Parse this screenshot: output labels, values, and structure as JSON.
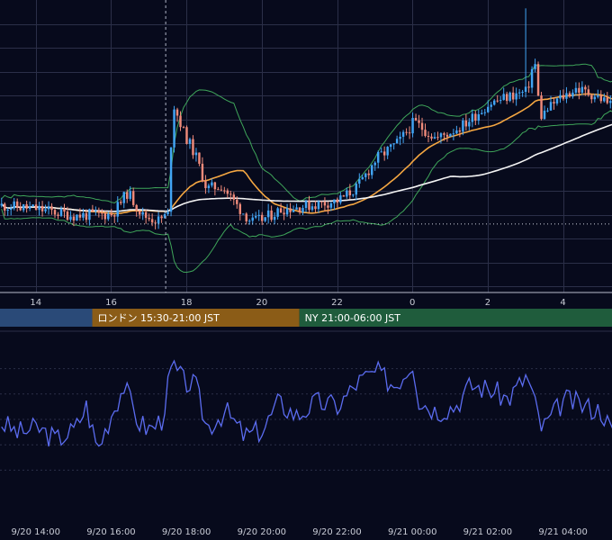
{
  "chart_data": [
    {
      "type": "candlestick",
      "x_ticks": [
        {
          "label": "14",
          "hours": 14
        },
        {
          "label": "16",
          "hours": 16
        },
        {
          "label": "18",
          "hours": 18
        },
        {
          "label": "20",
          "hours": 20
        },
        {
          "label": "22",
          "hours": 22
        },
        {
          "label": "0",
          "hours": 24
        },
        {
          "label": "2",
          "hours": 26
        },
        {
          "label": "4",
          "hours": 28
        }
      ],
      "x_range_hours": [
        13.05,
        29.3
      ],
      "price_anchors": [
        {
          "hours": 13.05,
          "price": 0.52
        },
        {
          "hours": 14.0,
          "price": 0.5
        },
        {
          "hours": 15.0,
          "price": 0.46
        },
        {
          "hours": 16.0,
          "price": 0.47
        },
        {
          "hours": 16.4,
          "price": 0.6
        },
        {
          "hours": 16.8,
          "price": 0.46
        },
        {
          "hours": 17.2,
          "price": 0.43
        },
        {
          "hours": 17.5,
          "price": 0.47
        },
        {
          "hours": 17.58,
          "price": 1.15
        },
        {
          "hours": 17.9,
          "price": 0.95
        },
        {
          "hours": 18.2,
          "price": 0.82
        },
        {
          "hours": 18.5,
          "price": 0.62
        },
        {
          "hours": 18.9,
          "price": 0.64
        },
        {
          "hours": 19.3,
          "price": 0.52
        },
        {
          "hours": 19.7,
          "price": 0.42
        },
        {
          "hours": 20.0,
          "price": 0.44
        },
        {
          "hours": 20.5,
          "price": 0.5
        },
        {
          "hours": 21.2,
          "price": 0.52
        },
        {
          "hours": 22.0,
          "price": 0.55
        },
        {
          "hours": 22.5,
          "price": 0.63
        },
        {
          "hours": 23.0,
          "price": 0.8
        },
        {
          "hours": 23.6,
          "price": 0.9
        },
        {
          "hours": 24.0,
          "price": 1.02
        },
        {
          "hours": 24.6,
          "price": 0.92
        },
        {
          "hours": 25.3,
          "price": 1.0
        },
        {
          "hours": 26.0,
          "price": 1.13
        },
        {
          "hours": 26.6,
          "price": 1.18
        },
        {
          "hours": 27.0,
          "price": 1.2
        },
        {
          "hours": 27.2,
          "price": 1.4
        },
        {
          "hours": 27.35,
          "price": 1.05
        },
        {
          "hours": 27.8,
          "price": 1.15
        },
        {
          "hours": 28.3,
          "price": 1.22
        },
        {
          "hours": 28.8,
          "price": 1.18
        },
        {
          "hours": 29.3,
          "price": 1.12
        }
      ],
      "spike_high": {
        "hours": 27.0,
        "price": 1.7
      },
      "dashed_price_level": 0.41,
      "vertical_marker_hours": 17.45,
      "y_range": [
        0,
        1.75
      ],
      "overlays": [
        "Bollinger Bands",
        "Moving Average",
        "Moving Average"
      ],
      "colors": {
        "up": "#42a5f5",
        "down": "#ef8a7a",
        "bollinger": "#3fa65a",
        "ma_short": "#f5a742",
        "ma_long": "#f4f4f4",
        "grid": "#2b2f48",
        "background": "#070a1c"
      },
      "grid": true
    },
    {
      "type": "line",
      "x_ticks": [
        {
          "label": "9/20 14:00",
          "hours": 14
        },
        {
          "label": "9/20 16:00",
          "hours": 16
        },
        {
          "label": "9/20 18:00",
          "hours": 18
        },
        {
          "label": "9/20 20:00",
          "hours": 20
        },
        {
          "label": "9/20 22:00",
          "hours": 22
        },
        {
          "label": "9/21 00:00",
          "hours": 24
        },
        {
          "label": "9/21 02:00",
          "hours": 26
        },
        {
          "label": "9/21 04:00",
          "hours": 28
        }
      ],
      "y_range": [
        0,
        100
      ],
      "anchors": [
        {
          "hours": 13.05,
          "value": 48
        },
        {
          "hours": 13.5,
          "value": 42
        },
        {
          "hours": 14.0,
          "value": 45
        },
        {
          "hours": 14.5,
          "value": 38
        },
        {
          "hours": 15.0,
          "value": 44
        },
        {
          "hours": 15.3,
          "value": 58
        },
        {
          "hours": 15.6,
          "value": 32
        },
        {
          "hours": 16.0,
          "value": 55
        },
        {
          "hours": 16.3,
          "value": 70
        },
        {
          "hours": 16.7,
          "value": 48
        },
        {
          "hours": 17.0,
          "value": 44
        },
        {
          "hours": 17.3,
          "value": 50
        },
        {
          "hours": 17.58,
          "value": 82
        },
        {
          "hours": 17.9,
          "value": 72
        },
        {
          "hours": 18.2,
          "value": 70
        },
        {
          "hours": 18.5,
          "value": 45
        },
        {
          "hours": 19.0,
          "value": 55
        },
        {
          "hours": 19.5,
          "value": 40
        },
        {
          "hours": 20.0,
          "value": 44
        },
        {
          "hours": 20.4,
          "value": 60
        },
        {
          "hours": 20.9,
          "value": 52
        },
        {
          "hours": 21.4,
          "value": 60
        },
        {
          "hours": 22.0,
          "value": 58
        },
        {
          "hours": 22.5,
          "value": 72
        },
        {
          "hours": 23.0,
          "value": 78
        },
        {
          "hours": 23.5,
          "value": 70
        },
        {
          "hours": 24.0,
          "value": 85
        },
        {
          "hours": 24.1,
          "value": 62
        },
        {
          "hours": 24.6,
          "value": 55
        },
        {
          "hours": 25.1,
          "value": 58
        },
        {
          "hours": 25.5,
          "value": 70
        },
        {
          "hours": 26.0,
          "value": 68
        },
        {
          "hours": 26.5,
          "value": 62
        },
        {
          "hours": 27.0,
          "value": 76
        },
        {
          "hours": 27.4,
          "value": 44
        },
        {
          "hours": 28.0,
          "value": 62
        },
        {
          "hours": 28.5,
          "value": 58
        },
        {
          "hours": 29.0,
          "value": 55
        },
        {
          "hours": 29.3,
          "value": 40
        }
      ],
      "colors": {
        "line": "#5b6cf0",
        "grid": "#2b2f48"
      },
      "grid": true
    }
  ],
  "sessions": [
    {
      "label": "",
      "color": "#2a4a78",
      "start_hours": 13.05,
      "end_hours": 15.5
    },
    {
      "label": "ロンドン 15:30-21:00 JST",
      "color": "#8b5c17",
      "start_hours": 15.5,
      "end_hours": 21.0
    },
    {
      "label": "NY 21:00-06:00 JST",
      "color": "#1f5c3c",
      "start_hours": 21.0,
      "end_hours": 29.3
    }
  ]
}
